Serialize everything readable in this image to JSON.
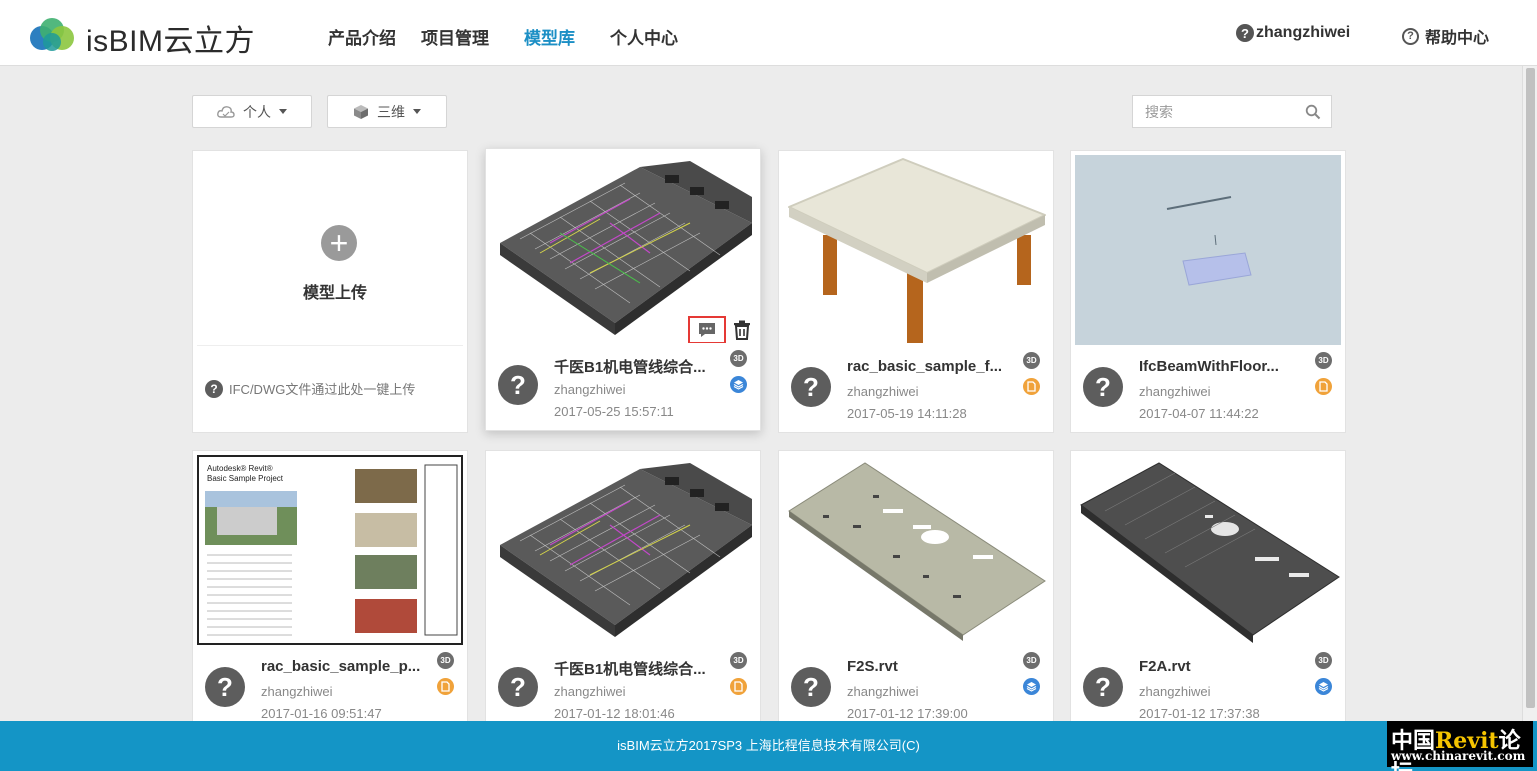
{
  "app": {
    "logo_text": "isBIM云立方"
  },
  "nav": {
    "items": [
      {
        "label": "产品介绍"
      },
      {
        "label": "项目管理"
      },
      {
        "label": "模型库"
      },
      {
        "label": "个人中心"
      }
    ],
    "active": "模型库",
    "user": "zhangzhiwei",
    "help": "帮助中心"
  },
  "toolbar": {
    "scope_label": "个人",
    "dimension_label": "三维",
    "search_placeholder": "搜索"
  },
  "upload": {
    "label": "模型上传",
    "tip": "IFC/DWG文件通过此处一键上传"
  },
  "cards": [
    {
      "name": "千医B1机电管线综合...",
      "user": "zhangzhiwei",
      "date": "2017-05-25 15:57:11",
      "badge": "3D",
      "type_icon": "layers-icon"
    },
    {
      "name": "rac_basic_sample_f...",
      "user": "zhangzhiwei",
      "date": "2017-05-19 14:11:28",
      "badge": "3D",
      "type_icon": "file-icon"
    },
    {
      "name": "IfcBeamWithFloor...",
      "user": "zhangzhiwei",
      "date": "2017-04-07 11:44:22",
      "badge": "3D",
      "type_icon": "file-icon"
    },
    {
      "name": "rac_basic_sample_p...",
      "user": "zhangzhiwei",
      "date": "2017-01-16 09:51:47",
      "badge": "3D",
      "type_icon": "file-icon"
    },
    {
      "name": "千医B1机电管线综合...",
      "user": "zhangzhiwei",
      "date": "2017-01-12 18:01:46",
      "badge": "3D",
      "type_icon": "file-icon"
    },
    {
      "name": "F2S.rvt",
      "user": "zhangzhiwei",
      "date": "2017-01-12 17:39:00",
      "badge": "3D",
      "type_icon": "layers-icon"
    },
    {
      "name": "F2A.rvt",
      "user": "zhangzhiwei",
      "date": "2017-01-12 17:37:38",
      "badge": "3D",
      "type_icon": "layers-icon"
    }
  ],
  "sheet_preview": {
    "title_line1": "Autodesk® Revit®",
    "title_line2": "Basic Sample Project"
  },
  "footer": {
    "text": "isBIM云立方2017SP3 上海比程信息技术有限公司(C)"
  },
  "watermark": {
    "line1_a": "中国",
    "line1_b": "Revit",
    "line1_c": "论坛",
    "line2": "www.chinarevit.com"
  },
  "colors": {
    "accent": "#1c8fc5",
    "footer": "#1495c6",
    "highlight": "#e53935"
  }
}
